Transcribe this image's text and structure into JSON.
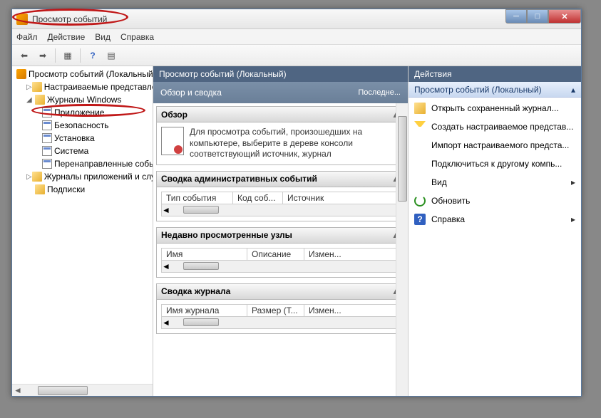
{
  "window": {
    "title": "Просмотр событий"
  },
  "menu": {
    "file": "Файл",
    "action": "Действие",
    "view": "Вид",
    "help": "Справка"
  },
  "tree": {
    "root": "Просмотр событий (Локальный)",
    "custom": "Настраиваемые представления",
    "winlogs": "Журналы Windows",
    "app": "Приложение",
    "sec": "Безопасность",
    "setup": "Установка",
    "sys": "Система",
    "fwd": "Перенаправленные события",
    "appsvc": "Журналы приложений и служб",
    "subs": "Подписки"
  },
  "center": {
    "header": "Просмотр событий (Локальный)",
    "subheader": "Обзор и сводка",
    "subright": "Последне...",
    "overview": {
      "title": "Обзор",
      "text": "Для просмотра событий, произошедших на компьютере, выберите в дереве консоли соответствующий источник, журнал"
    },
    "admin": {
      "title": "Сводка административных событий",
      "col1": "Тип события",
      "col2": "Код соб...",
      "col3": "Источник"
    },
    "recent": {
      "title": "Недавно просмотренные узлы",
      "col1": "Имя",
      "col2": "Описание",
      "col3": "Измен..."
    },
    "summary": {
      "title": "Сводка журнала",
      "col1": "Имя журнала",
      "col2": "Размер (Т...",
      "col3": "Измен..."
    }
  },
  "actions": {
    "header": "Действия",
    "sub": "Просмотр событий (Локальный)",
    "open": "Открыть сохраненный журнал...",
    "create": "Создать настраиваемое представ...",
    "import": "Импорт настраиваемого предста...",
    "connect": "Подключиться к другому компь...",
    "view": "Вид",
    "refresh": "Обновить",
    "help": "Справка"
  }
}
